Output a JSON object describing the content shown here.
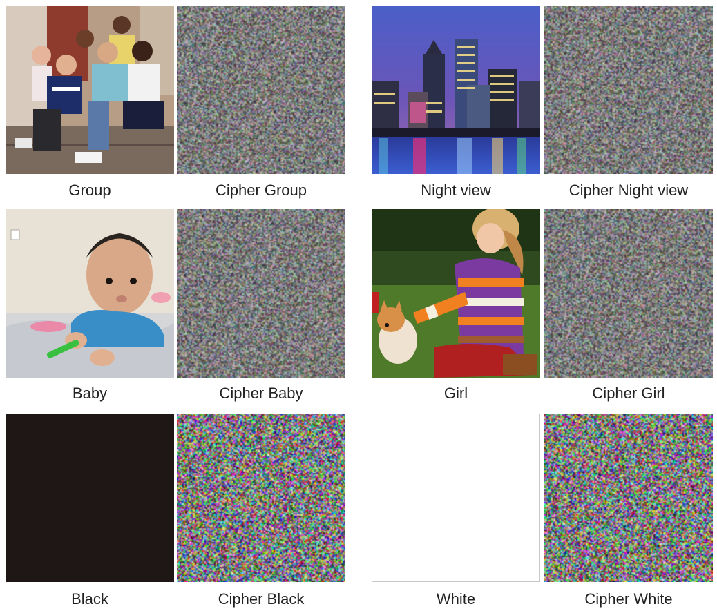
{
  "figure": {
    "pairs": [
      {
        "plain_label": "Group",
        "cipher_label": "Cipher Group"
      },
      {
        "plain_label": "Night view",
        "cipher_label": "Cipher Night view"
      },
      {
        "plain_label": "Baby",
        "cipher_label": "Cipher Baby"
      },
      {
        "plain_label": "Girl",
        "cipher_label": "Cipher Girl"
      },
      {
        "plain_label": "Black",
        "cipher_label": "Cipher Black"
      },
      {
        "plain_label": "White",
        "cipher_label": "Cipher White"
      }
    ],
    "colors": {
      "black_image": "#1f1716",
      "white_image": "#ffffff",
      "white_border": "#c8c8c8",
      "caption": "#222222"
    }
  }
}
